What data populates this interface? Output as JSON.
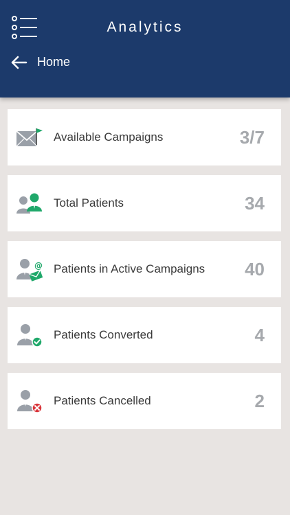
{
  "header": {
    "title": "Analytics",
    "breadcrumb": "Home",
    "menu_icon": "list-menu-icon",
    "back_icon": "arrow-left-icon"
  },
  "colors": {
    "header_bg": "#1c3a6b",
    "page_bg": "#e8e4e2",
    "accent_green": "#1fa86a",
    "person_gray": "#9aa0a8",
    "cancel_red": "#d9343a",
    "value_gray": "#a6a9ad"
  },
  "stats": [
    {
      "label": "Available Campaigns",
      "value": "3/7",
      "icon": "envelope-flag-icon"
    },
    {
      "label": "Total Patients",
      "value": "34",
      "icon": "patients-group-icon"
    },
    {
      "label": "Patients in Active Campaigns",
      "value": "40",
      "icon": "patient-email-icon"
    },
    {
      "label": "Patients Converted",
      "value": "4",
      "icon": "patient-check-icon"
    },
    {
      "label": "Patients Cancelled",
      "value": "2",
      "icon": "patient-cancel-icon"
    }
  ]
}
